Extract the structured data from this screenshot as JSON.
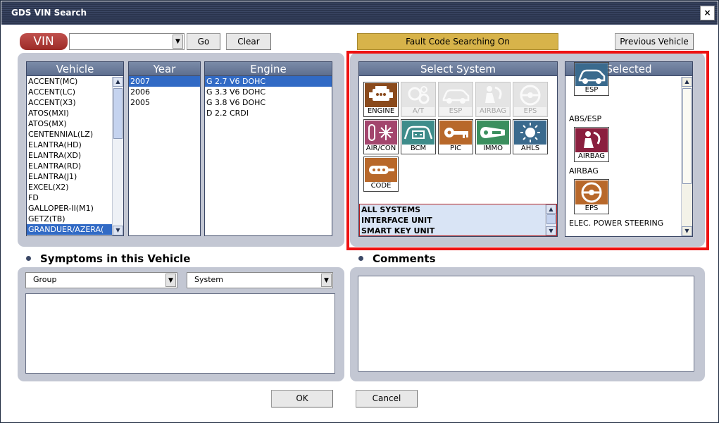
{
  "window": {
    "title": "GDS VIN Search",
    "close_glyph": "×"
  },
  "toolbar": {
    "vin_label": "VIN",
    "vin_value": "",
    "go_label": "Go",
    "clear_label": "Clear",
    "fault_code_status": "Fault Code Searching On",
    "previous_vehicle_label": "Previous Vehicle"
  },
  "vehicle_list": {
    "header": "Vehicle",
    "items": [
      "ACCENT(MC)",
      "ACCENT(LC)",
      "ACCENT(X3)",
      "ATOS(MXI)",
      "ATOS(MX)",
      "CENTENNIAL(LZ)",
      "ELANTRA(HD)",
      "ELANTRA(XD)",
      "ELANTRA(RD)",
      "ELANTRA(J1)",
      "EXCEL(X2)",
      "FD",
      "GALLOPER-II(M1)",
      "GETZ(TB)",
      "GRANDUER/AZERA("
    ],
    "selected_index": 14
  },
  "year_list": {
    "header": "Year",
    "items": [
      "2007",
      "2006",
      "2005"
    ],
    "selected_index": 0
  },
  "engine_list": {
    "header": "Engine",
    "items": [
      "G 2.7 V6 DOHC",
      "G 3.3 V6 DOHC",
      "G 3.8 V6 DOHC",
      "D 2.2 CRDI"
    ],
    "selected_index": 0
  },
  "select_system": {
    "header": "Select System",
    "tiles": [
      {
        "label": "ENGINE",
        "icon": "engine-icon",
        "enabled": true,
        "color": "#8a4a1c"
      },
      {
        "label": "A/T",
        "icon": "gears-icon",
        "enabled": false,
        "color": "#e4e4e4"
      },
      {
        "label": "ESP",
        "icon": "car-icon",
        "enabled": false,
        "color": "#e4e4e4"
      },
      {
        "label": "AIRBAG",
        "icon": "airbag-icon",
        "enabled": false,
        "color": "#e4e4e4"
      },
      {
        "label": "EPS",
        "icon": "steering-wheel-icon",
        "enabled": false,
        "color": "#e4e4e4"
      },
      {
        "label": "AIR/CON",
        "icon": "snowflake-icon",
        "enabled": true,
        "color": "#a3456d"
      },
      {
        "label": "BCM",
        "icon": "battery-car-icon",
        "enabled": true,
        "color": "#3e8c8a"
      },
      {
        "label": "PIC",
        "icon": "key-icon",
        "enabled": true,
        "color": "#b8682a"
      },
      {
        "label": "IMMO",
        "icon": "key-fob-icon",
        "enabled": true,
        "color": "#3b8f5e"
      },
      {
        "label": "AHLS",
        "icon": "headlamp-icon",
        "enabled": true,
        "color": "#3a6a8d"
      },
      {
        "label": "CODE",
        "icon": "remote-key-icon",
        "enabled": true,
        "color": "#b8682a"
      }
    ],
    "filter_list": [
      "ALL SYSTEMS",
      "INTERFACE UNIT",
      "SMART KEY UNIT"
    ]
  },
  "selected_systems": {
    "header": "Selected",
    "items": [
      {
        "tile_label": "ESP",
        "name": "ABS/ESP",
        "icon": "car-icon",
        "color": "#3a6a8d"
      },
      {
        "tile_label": "AIRBAG",
        "name": "AIRBAG",
        "icon": "airbag-icon",
        "color": "#8a1f3e"
      },
      {
        "tile_label": "EPS",
        "name": "ELEC. POWER STEERING",
        "icon": "steering-wheel-icon",
        "color": "#b8682a"
      }
    ]
  },
  "symptoms": {
    "title": "Symptoms in this Vehicle",
    "group_value": "Group",
    "system_value": "System"
  },
  "comments": {
    "title": "Comments"
  },
  "footer": {
    "ok_label": "OK",
    "cancel_label": "Cancel"
  },
  "colors": {
    "highlight_frame": "#ee1111",
    "selection": "#316ac5",
    "fault_bar": "#d7b34a",
    "panel": "#c3c7d3"
  }
}
